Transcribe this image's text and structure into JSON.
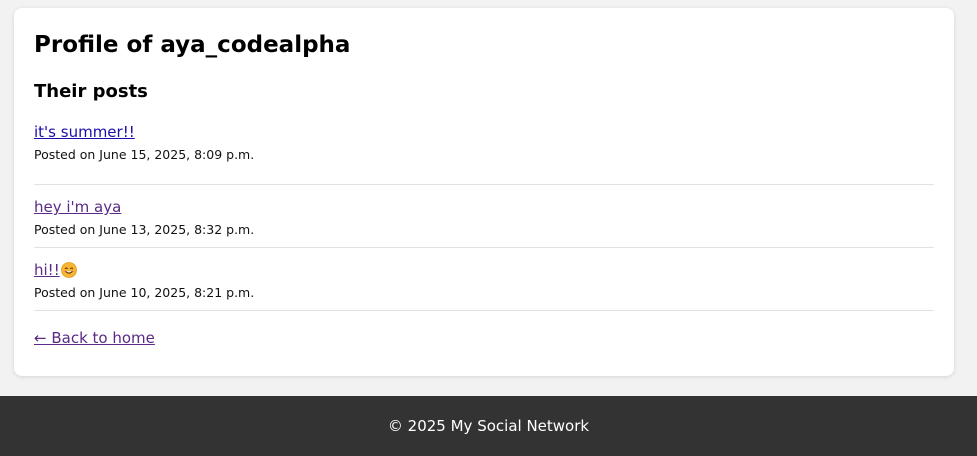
{
  "profile": {
    "title": "Profile of aya_codealpha",
    "posts_heading": "Their posts",
    "posts": [
      {
        "title": "it's summer!!",
        "date": "Posted on June 15, 2025, 8:09 p.m.",
        "visited": false,
        "emoji": ""
      },
      {
        "title": "hey i'm aya",
        "date": "Posted on June 13, 2025, 8:32 p.m.",
        "visited": true,
        "emoji": ""
      },
      {
        "title": "hi!!",
        "date": "Posted on June 10, 2025, 8:21 p.m.",
        "visited": true,
        "emoji": "smiling-face-icon"
      }
    ],
    "back_link": "← Back to home"
  },
  "footer": {
    "text": "© 2025 My Social Network"
  },
  "colors": {
    "page_bg": "#f2f2f2",
    "card_bg": "#ffffff",
    "link_unvisited": "#1a0dab",
    "link_visited": "#5a2a86",
    "footer_bg": "#333333"
  }
}
